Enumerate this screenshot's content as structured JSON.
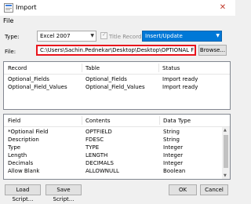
{
  "window": {
    "title": "Import",
    "close_glyph": "✕"
  },
  "menu": {
    "file": "File"
  },
  "type_row": {
    "type_label": "Type:",
    "type_value": "Excel 2007",
    "title_record_label": "Title Record",
    "title_record_checked": true,
    "mode_value": "Insert/Update"
  },
  "file_row": {
    "file_label": "File:",
    "file_value": "C:\\Users\\Sachin.Pednekar\\Desktop\\Desktop\\OPTIONAL FIEL",
    "browse_label": "Browse..."
  },
  "records": {
    "headers": [
      "Record",
      "Table",
      "Status"
    ],
    "rows": [
      [
        "Optional_Fields",
        "Optional_Fields",
        "Import ready"
      ],
      [
        "Optional_Field_Values",
        "Optional_Field_Values",
        "Import ready"
      ]
    ]
  },
  "fields": {
    "headers": [
      "Field",
      "Contents",
      "Data Type"
    ],
    "rows": [
      [
        "*Optional Field",
        "OPTFIELD",
        "String"
      ],
      [
        "Description",
        "FDESC",
        "String"
      ],
      [
        "Type",
        "TYPE",
        "Integer"
      ],
      [
        "Length",
        "LENGTH",
        "Integer"
      ],
      [
        "Decimals",
        "DECIMALS",
        "Integer"
      ],
      [
        "Allow Blank",
        "ALLOWNULL",
        "Boolean"
      ]
    ]
  },
  "buttons": {
    "load_script": "Load Script...",
    "save_script": "Save Script...",
    "ok": "OK",
    "cancel": "Cancel"
  },
  "icons": {
    "app": "import-app-icon",
    "close": "close-icon",
    "dropdown": "chevron-down-icon",
    "checkbox": "checkmark-icon",
    "scroll_up": "scroll-up-icon",
    "scroll_down": "scroll-down-icon"
  },
  "colors": {
    "selection": "#0078d7",
    "file_highlight": "#e8141c",
    "panel_border": "#828790"
  }
}
